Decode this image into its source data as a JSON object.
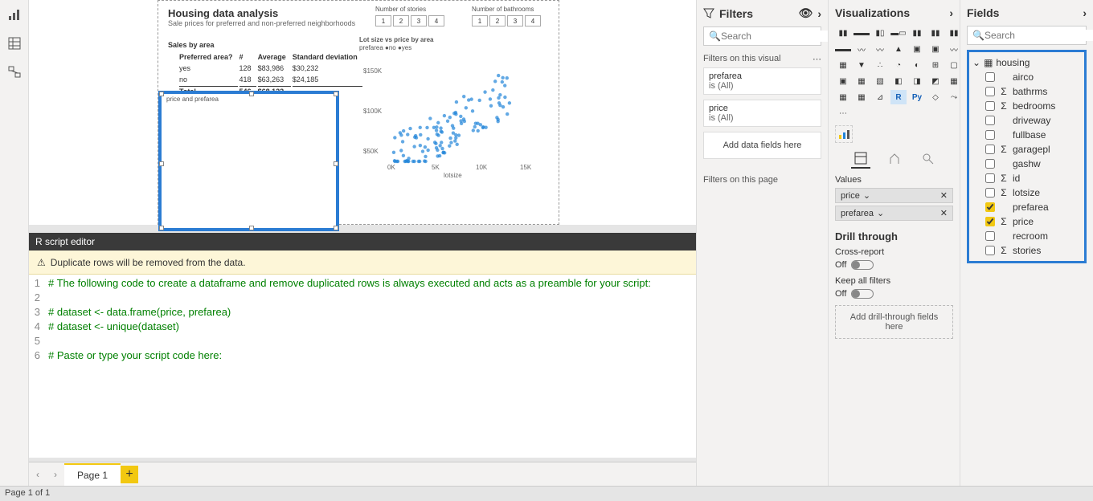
{
  "left_rail": {
    "icons": [
      "report-view-icon",
      "data-view-icon",
      "model-view-icon"
    ]
  },
  "report": {
    "title": "Housing data analysis",
    "subtitle": "Sale prices for preferred and non-preferred neighborhoods",
    "sales_title": "Sales by area",
    "table_headers": [
      "Preferred area?",
      "#",
      "Average",
      "Standard deviation"
    ],
    "table_rows": [
      {
        "c0": "yes",
        "c1": "128",
        "c2": "$83,986",
        "c3": "$30,232"
      },
      {
        "c0": "no",
        "c1": "418",
        "c2": "$63,263",
        "c3": "$24,185"
      }
    ],
    "table_total": {
      "c0": "Total",
      "c1": "546",
      "c2": "$68,122",
      "c3": ""
    },
    "slicer_stories": {
      "title": "Number of stories",
      "vals": [
        "1",
        "2",
        "3",
        "4"
      ]
    },
    "slicer_baths": {
      "title": "Number of bathrooms",
      "vals": [
        "1",
        "2",
        "3",
        "4"
      ]
    },
    "scatter_title": "Lot size vs price by area",
    "scatter_legend": "prefarea ●no ●yes",
    "scatter_y": [
      "$150K",
      "$100K",
      "$50K"
    ],
    "scatter_x": [
      "0K",
      "5K",
      "10K",
      "15K"
    ],
    "scatter_xlabel": "lotsize",
    "r_visual_label": "price and prefarea"
  },
  "script_editor": {
    "title": "R script editor",
    "warning": "Duplicate rows will be removed from the data.",
    "lines": [
      "# The following code to create a dataframe and remove duplicated rows is always executed and acts as a preamble for your script:",
      "",
      "# dataset <- data.frame(price, prefarea)",
      "# dataset <- unique(dataset)",
      "",
      "# Paste or type your script code here:"
    ]
  },
  "page_tabs": {
    "page1": "Page 1"
  },
  "status": "Page 1 of 1",
  "filters": {
    "title": "Filters",
    "search_placeholder": "Search",
    "visual_label": "Filters on this visual",
    "page_label": "Filters on this page",
    "cards": [
      {
        "name": "prefarea",
        "state": "is (All)"
      },
      {
        "name": "price",
        "state": "is (All)"
      }
    ],
    "add_here": "Add data fields here"
  },
  "viz": {
    "title": "Visualizations",
    "values_label": "Values",
    "pills": [
      "price",
      "prefarea"
    ],
    "drill_title": "Drill through",
    "cross_report": "Cross-report",
    "keep_filters": "Keep all filters",
    "off": "Off",
    "drill_add": "Add drill-through fields here"
  },
  "fields": {
    "title": "Fields",
    "search_placeholder": "Search",
    "table": "housing",
    "items": [
      {
        "name": "airco",
        "sum": false,
        "checked": false
      },
      {
        "name": "bathrms",
        "sum": true,
        "checked": false
      },
      {
        "name": "bedrooms",
        "sum": true,
        "checked": false
      },
      {
        "name": "driveway",
        "sum": false,
        "checked": false
      },
      {
        "name": "fullbase",
        "sum": false,
        "checked": false
      },
      {
        "name": "garagepl",
        "sum": true,
        "checked": false
      },
      {
        "name": "gashw",
        "sum": false,
        "checked": false
      },
      {
        "name": "id",
        "sum": true,
        "checked": false
      },
      {
        "name": "lotsize",
        "sum": true,
        "checked": false
      },
      {
        "name": "prefarea",
        "sum": false,
        "checked": true
      },
      {
        "name": "price",
        "sum": true,
        "checked": true
      },
      {
        "name": "recroom",
        "sum": false,
        "checked": false
      },
      {
        "name": "stories",
        "sum": true,
        "checked": false
      }
    ]
  }
}
